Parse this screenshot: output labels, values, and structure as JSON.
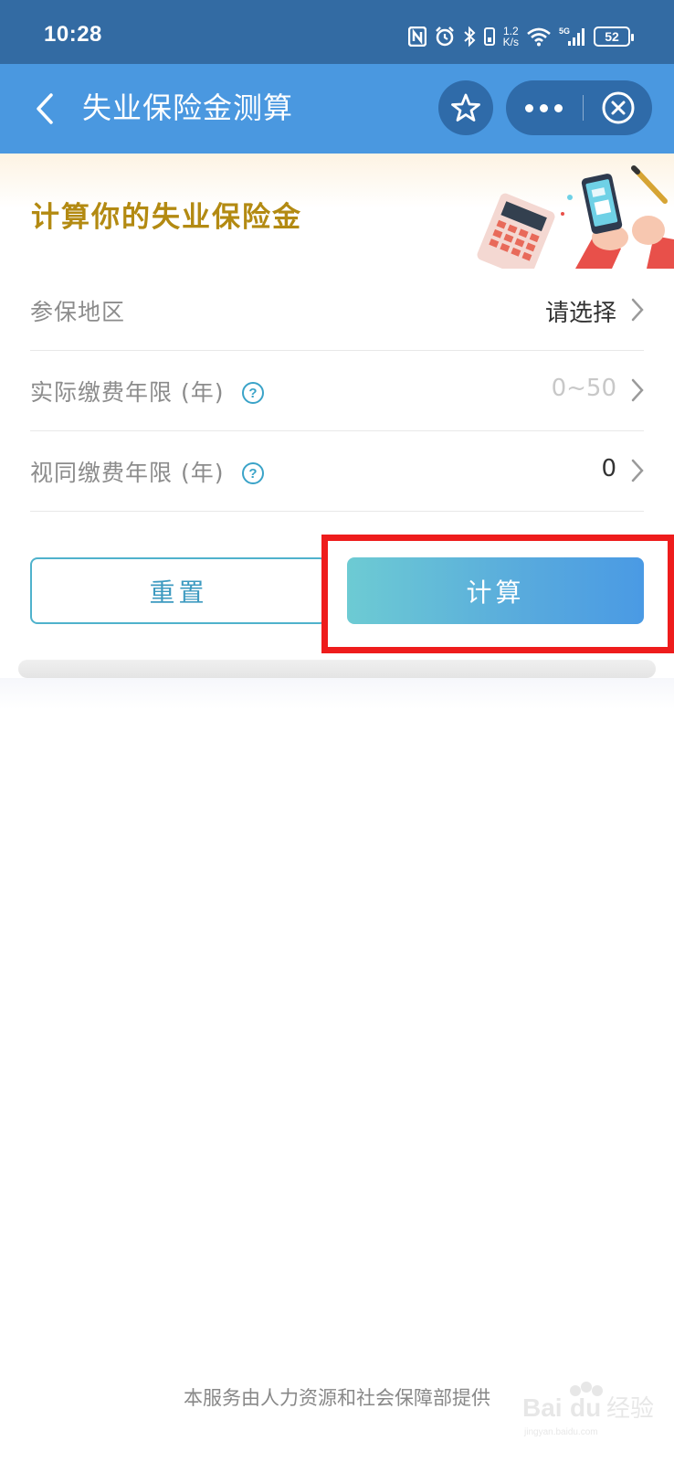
{
  "status_bar": {
    "time": "10:28",
    "network_speed": "1.2\nK/s",
    "network_speed_top": "1.2",
    "network_speed_bottom": "K/s",
    "battery": "52",
    "icons": [
      "nfc-icon",
      "alarm-icon",
      "bluetooth-icon",
      "vibrate-icon",
      "wifi-icon",
      "signal-5g-icon",
      "battery-icon"
    ]
  },
  "header": {
    "title": "失业保险金测算",
    "icons": [
      "back-arrow-icon",
      "star-icon",
      "more-icon",
      "close-circle-icon"
    ]
  },
  "banner": {
    "title": "计算你的失业保险金"
  },
  "form": {
    "rows": [
      {
        "label": "参保地区",
        "value": "请选择",
        "has_help": false
      },
      {
        "label": "实际缴费年限 (年)",
        "value": "0~50",
        "has_help": true
      },
      {
        "label": "视同缴费年限 (年)",
        "value": "0",
        "has_help": true
      }
    ]
  },
  "buttons": {
    "reset": "重置",
    "calculate": "计算"
  },
  "footer": {
    "provider": "本服务由人力资源和社会保障部提供"
  },
  "colors": {
    "status_bar": "#336ba3",
    "title_bar": "#4a98e0",
    "banner_title": "#b38a12",
    "accent": "#4fb2cc",
    "highlight": "#ee1c1c"
  }
}
